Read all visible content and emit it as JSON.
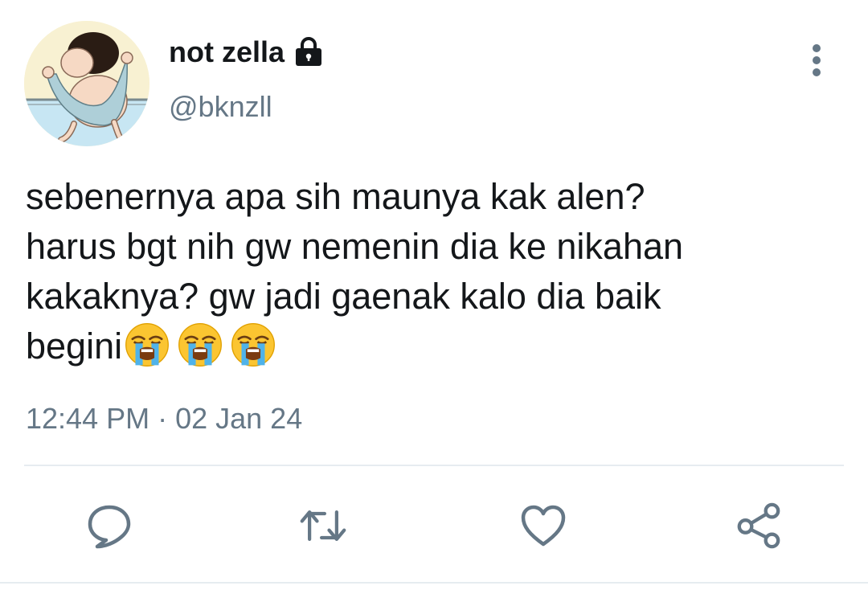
{
  "user": {
    "display_name": "not zella",
    "handle": "@bknzll",
    "protected_icon": "lock-icon",
    "avatar": "cartoon-avatar"
  },
  "tweet": {
    "lines": [
      "sebenernya apa sih maunya kak alen?",
      "harus bgt nih gw nemenin dia ke nikahan",
      "kakaknya? gw jadi gaenak kalo dia baik",
      "begini"
    ],
    "emojis": [
      "loudly-crying-face",
      "loudly-crying-face",
      "loudly-crying-face"
    ],
    "timestamp": "12:44 PM · 02 Jan 24"
  },
  "actions": [
    "reply-icon",
    "retweet-icon",
    "like-icon",
    "share-icon"
  ],
  "colors": {
    "text": "#14171a",
    "secondary": "#657786",
    "divider": "#e6ecf0"
  }
}
